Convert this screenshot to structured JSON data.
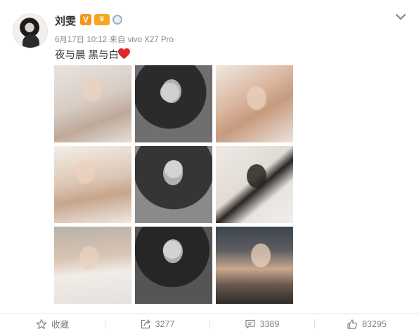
{
  "user": {
    "name": "刘雯",
    "verified_label": "V"
  },
  "post": {
    "timestamp": "6月17日 10:12",
    "source": "来自 vivo X27 Pro",
    "text": "夜与晨 黑与白"
  },
  "photos": [
    {
      "icon": "photo-1"
    },
    {
      "icon": "photo-2"
    },
    {
      "icon": "photo-3"
    },
    {
      "icon": "photo-4"
    },
    {
      "icon": "photo-5"
    },
    {
      "icon": "photo-6"
    },
    {
      "icon": "photo-7"
    },
    {
      "icon": "photo-8"
    },
    {
      "icon": "photo-9"
    }
  ],
  "actions": {
    "favorite_label": "收藏",
    "repost_count": "3277",
    "comment_count": "3389",
    "like_count": "83295"
  },
  "colors": {
    "badge_orange": "#f7941d",
    "heart_red": "#e0262b",
    "meta_gray": "#888888"
  }
}
